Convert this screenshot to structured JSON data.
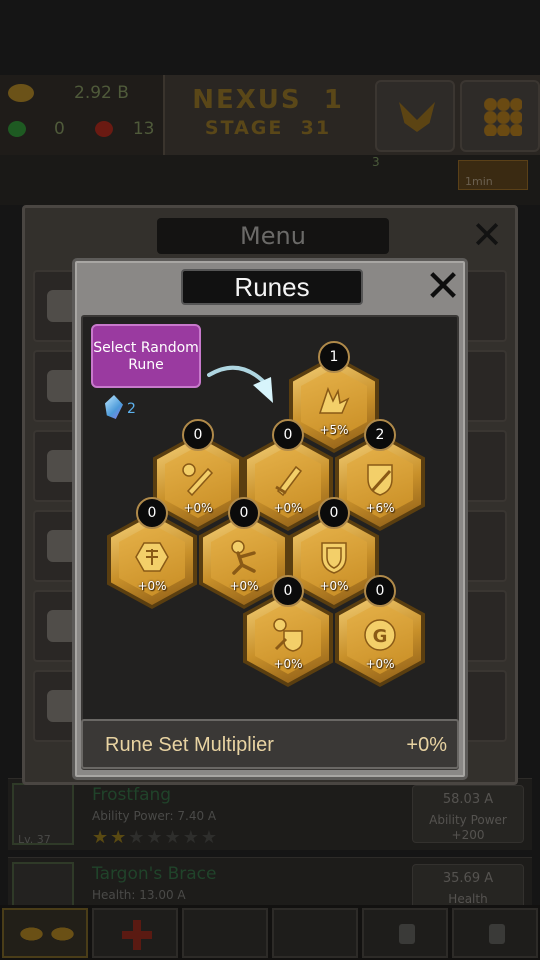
{
  "hud": {
    "gold": "2.92 B",
    "green_gems": "0",
    "red_gems": "13",
    "world": "NEXUS",
    "world_num": "1",
    "stage_label": "STAGE",
    "stage_num": "31",
    "strip_count": "3",
    "timer": "1min"
  },
  "menu": {
    "title": "Menu"
  },
  "runes": {
    "title": "Runes",
    "select_button": "Select Random Rune",
    "crystal_count": "2",
    "hexes": [
      {
        "count": "1",
        "bonus": "+5%",
        "icon": "wing-rune-icon"
      },
      {
        "count": "0",
        "bonus": "+0%",
        "icon": "hero-sword-rune-icon"
      },
      {
        "count": "0",
        "bonus": "+0%",
        "icon": "sword-rune-icon"
      },
      {
        "count": "2",
        "bonus": "+6%",
        "icon": "shield-sword-rune-icon"
      },
      {
        "count": "0",
        "bonus": "+0%",
        "icon": "emblem-rune-icon"
      },
      {
        "count": "0",
        "bonus": "+0%",
        "icon": "hero-rune-icon"
      },
      {
        "count": "0",
        "bonus": "+0%",
        "icon": "shield-rune-icon"
      },
      {
        "count": "0",
        "bonus": "+0%",
        "icon": "hero-shield-rune-icon"
      },
      {
        "count": "0",
        "bonus": "+0%",
        "icon": "gold-coin-rune-icon"
      }
    ],
    "multiplier_label": "Rune Set Multiplier",
    "multiplier_value": "+0%"
  },
  "items": [
    {
      "level": "Lv. 37",
      "name": "Frostfang",
      "stat": "Ability Power: 7.40 A",
      "stars_on": "★★",
      "stars_off": "★★★★★",
      "price": "58.03 A",
      "gain": "Ability Power\n+200"
    },
    {
      "level": "",
      "name": "Targon's Brace",
      "stat": "Health: 13.00 A",
      "stars_on": "",
      "stars_off": "",
      "price": "35.69 A",
      "gain": "Health"
    }
  ],
  "colors": {
    "rune_gold": "#d9a33c",
    "select_purple": "#9a3aa0",
    "crystal_blue": "#5db2ee"
  }
}
